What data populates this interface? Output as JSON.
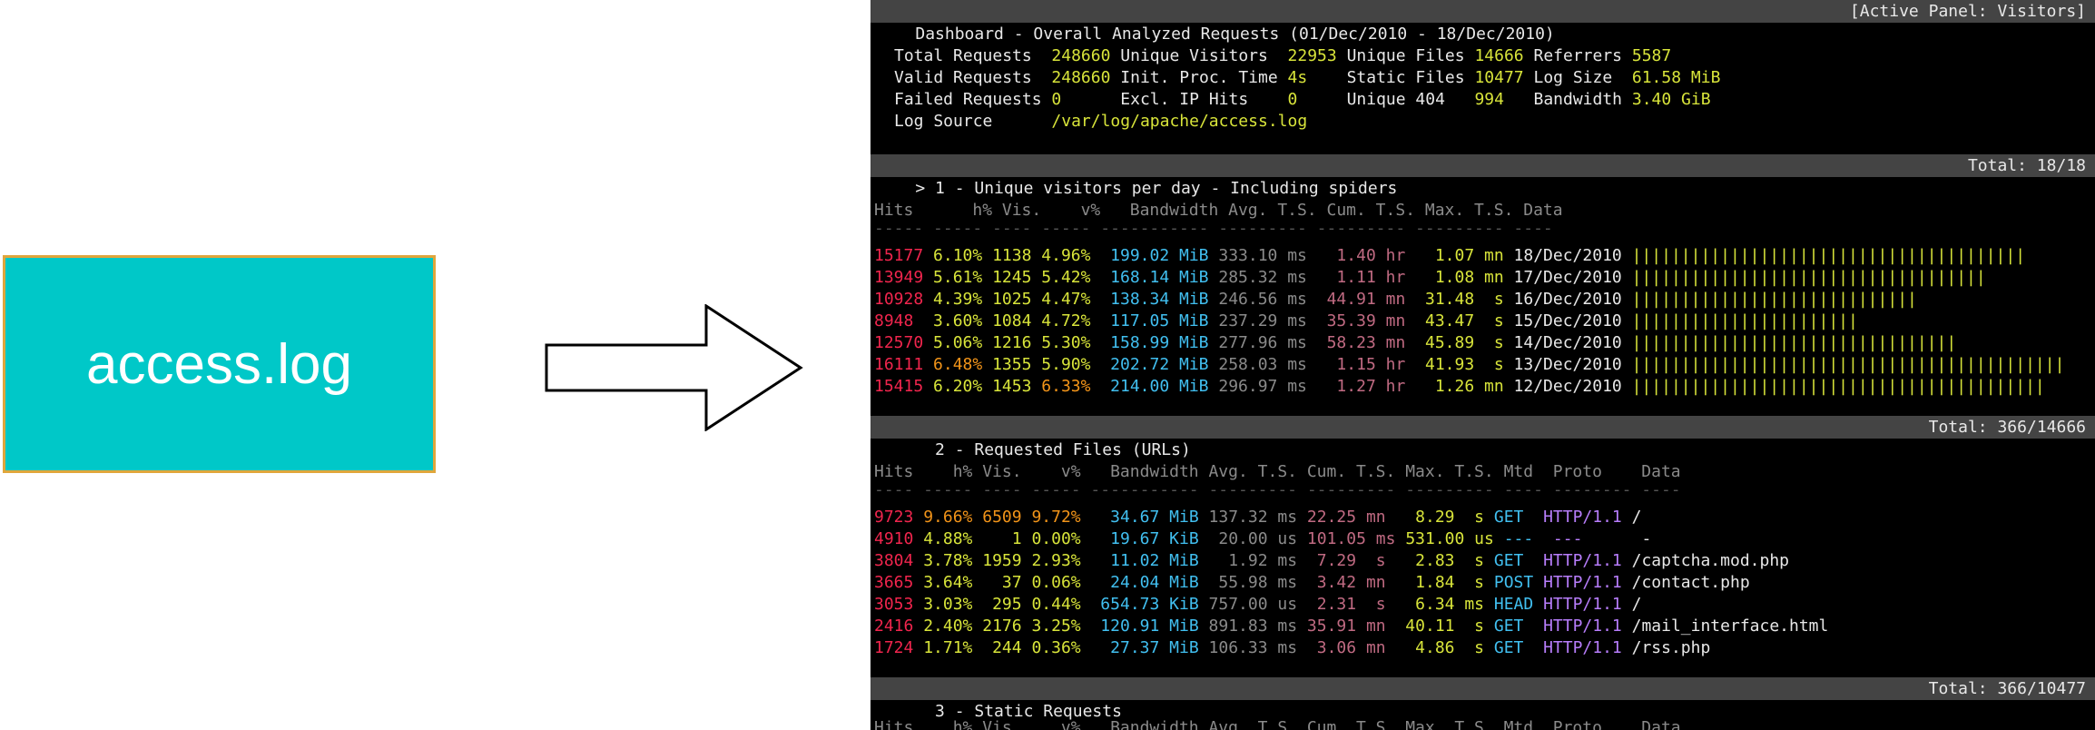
{
  "input_box": {
    "label": "access.log",
    "bg": "#00c8c8",
    "border": "#e0a63c"
  },
  "dashboard": {
    "title": "Dashboard - Overall Analyzed Requests (01/Dec/2010 - 18/Dec/2010)",
    "active_panel": "[Active Panel: Visitors]",
    "general": {
      "total_requests_label": "Total Requests",
      "total_requests": "248660",
      "unique_visitors_label": "Unique Visitors",
      "unique_visitors": "22953",
      "unique_files_label": "Unique Files",
      "unique_files": "14666",
      "referrers_label": "Referrers",
      "referrers": "5587",
      "valid_requests_label": "Valid Requests",
      "valid_requests": "248660",
      "init_proc_label": "Init. Proc. Time",
      "init_proc": "4s",
      "static_files_label": "Static Files",
      "static_files": "10477",
      "log_size_label": "Log Size",
      "log_size": "61.58 MiB",
      "failed_requests_label": "Failed Requests",
      "failed_requests": "0",
      "excl_ip_label": "Excl. IP Hits",
      "excl_ip": "0",
      "unique404_label": "Unique 404",
      "unique404": "994",
      "bandwidth_label": "Bandwidth",
      "bandwidth": "3.40 GiB",
      "log_source_label": "Log Source",
      "log_source": "/var/log/apache/access.log"
    },
    "panel1": {
      "title": "> 1 - Unique visitors per day - Including spiders",
      "total": "Total: 18/18",
      "header": "Hits      h% Vis.    v%   Bandwidth Avg. T.S. Cum. T.S. Max. T.S. Data",
      "underline": "----- ----- ---- ----- ----------- --------- --------- --------- ----",
      "rows": [
        {
          "hits": "15177",
          "hp": "6.10%",
          "vis": "1138",
          "vp": "4.96%",
          "bw": "199.02 MiB",
          "avg": "333.10 ms",
          "cum": " 1.40 hr",
          "max": " 1.07 mn",
          "date": "18/Dec/2010",
          "bars": "||||||||||||||||||||||||||||||||||||||||",
          "hp_hl": false,
          "vp_hl": false
        },
        {
          "hits": "13949",
          "hp": "5.61%",
          "vis": "1245",
          "vp": "5.42%",
          "bw": "168.14 MiB",
          "avg": "285.32 ms",
          "cum": " 1.11 hr",
          "max": " 1.08 mn",
          "date": "17/Dec/2010",
          "bars": "||||||||||||||||||||||||||||||||||||",
          "hp_hl": false,
          "vp_hl": false
        },
        {
          "hits": "10928",
          "hp": "4.39%",
          "vis": "1025",
          "vp": "4.47%",
          "bw": "138.34 MiB",
          "avg": "246.56 ms",
          "cum": "44.91 mn",
          "max": "31.48  s",
          "date": "16/Dec/2010",
          "bars": "|||||||||||||||||||||||||||||",
          "hp_hl": false,
          "vp_hl": false
        },
        {
          "hits": "8948 ",
          "hp": "3.60%",
          "vis": "1084",
          "vp": "4.72%",
          "bw": "117.05 MiB",
          "avg": "237.29 ms",
          "cum": "35.39 mn",
          "max": "43.47  s",
          "date": "15/Dec/2010",
          "bars": "|||||||||||||||||||||||",
          "hp_hl": false,
          "vp_hl": false
        },
        {
          "hits": "12570",
          "hp": "5.06%",
          "vis": "1216",
          "vp": "5.30%",
          "bw": "158.99 MiB",
          "avg": "277.96 ms",
          "cum": "58.23 mn",
          "max": "45.89  s",
          "date": "14/Dec/2010",
          "bars": "|||||||||||||||||||||||||||||||||",
          "hp_hl": false,
          "vp_hl": false
        },
        {
          "hits": "16111",
          "hp": "6.48%",
          "vis": "1355",
          "vp": "5.90%",
          "bw": "202.72 MiB",
          "avg": "258.03 ms",
          "cum": " 1.15 hr",
          "max": "41.93  s",
          "date": "13/Dec/2010",
          "bars": "||||||||||||||||||||||||||||||||||||||||||||",
          "hp_hl": true,
          "vp_hl": false
        },
        {
          "hits": "15415",
          "hp": "6.20%",
          "vis": "1453",
          "vp": "6.33%",
          "bw": "214.00 MiB",
          "avg": "296.97 ms",
          "cum": " 1.27 hr",
          "max": " 1.26 mn",
          "date": "12/Dec/2010",
          "bars": "||||||||||||||||||||||||||||||||||||||||||",
          "hp_hl": false,
          "vp_hl": true
        }
      ]
    },
    "panel2": {
      "title": "  2 - Requested Files (URLs)",
      "total": "Total: 366/14666",
      "header": "Hits    h% Vis.    v%   Bandwidth Avg. T.S. Cum. T.S. Max. T.S. Mtd  Proto    Data",
      "underline": "---- ----- ---- ----- ----------- --------- --------- --------- ---- -------- ----",
      "rows": [
        {
          "hits": "9723",
          "hp": "9.66%",
          "vis": "6509",
          "vp": "9.72%",
          "bw": "  34.67 MiB",
          "avg": "137.32 ms",
          "cum": "22.25 mn",
          "max": "  8.29  s",
          "mtd": "GET ",
          "proto": "HTTP/1.1",
          "data": "/",
          "hl": true
        },
        {
          "hits": "4910",
          "hp": "4.88%",
          "vis": "   1",
          "vp": "0.00%",
          "bw": "  19.67 KiB",
          "avg": " 20.00 us",
          "cum": "101.05 ms",
          "max": "531.00 us",
          "mtd": "--- ",
          "proto": "---     ",
          "data": "-",
          "hl": false
        },
        {
          "hits": "3804",
          "hp": "3.78%",
          "vis": "1959",
          "vp": "2.93%",
          "bw": "  11.02 MiB",
          "avg": "  1.92 ms",
          "cum": " 7.29  s",
          "max": "  2.83  s",
          "mtd": "GET ",
          "proto": "HTTP/1.1",
          "data": "/captcha.mod.php",
          "hl": false
        },
        {
          "hits": "3665",
          "hp": "3.64%",
          "vis": "  37",
          "vp": "0.06%",
          "bw": "  24.04 MiB",
          "avg": " 55.98 ms",
          "cum": " 3.42 mn",
          "max": "  1.84  s",
          "mtd": "POST",
          "proto": "HTTP/1.1",
          "data": "/contact.php",
          "hl": false
        },
        {
          "hits": "3053",
          "hp": "3.03%",
          "vis": " 295",
          "vp": "0.44%",
          "bw": " 654.73 KiB",
          "avg": "757.00 us",
          "cum": " 2.31  s",
          "max": "  6.34 ms",
          "mtd": "HEAD",
          "proto": "HTTP/1.1",
          "data": "/",
          "hl": false
        },
        {
          "hits": "2416",
          "hp": "2.40%",
          "vis": "2176",
          "vp": "3.25%",
          "bw": " 120.91 MiB",
          "avg": "891.83 ms",
          "cum": "35.91 mn",
          "max": " 40.11  s",
          "mtd": "GET ",
          "proto": "HTTP/1.1",
          "data": "/mail_interface.html",
          "hl": false
        },
        {
          "hits": "1724",
          "hp": "1.71%",
          "vis": " 244",
          "vp": "0.36%",
          "bw": "  27.37 MiB",
          "avg": "106.33 ms",
          "cum": " 3.06 mn",
          "max": "  4.86  s",
          "mtd": "GET ",
          "proto": "HTTP/1.1",
          "data": "/rss.php",
          "hl": false
        }
      ]
    },
    "panel3": {
      "title": "  3 - Static Requests",
      "total": "Total: 366/10477"
    }
  }
}
